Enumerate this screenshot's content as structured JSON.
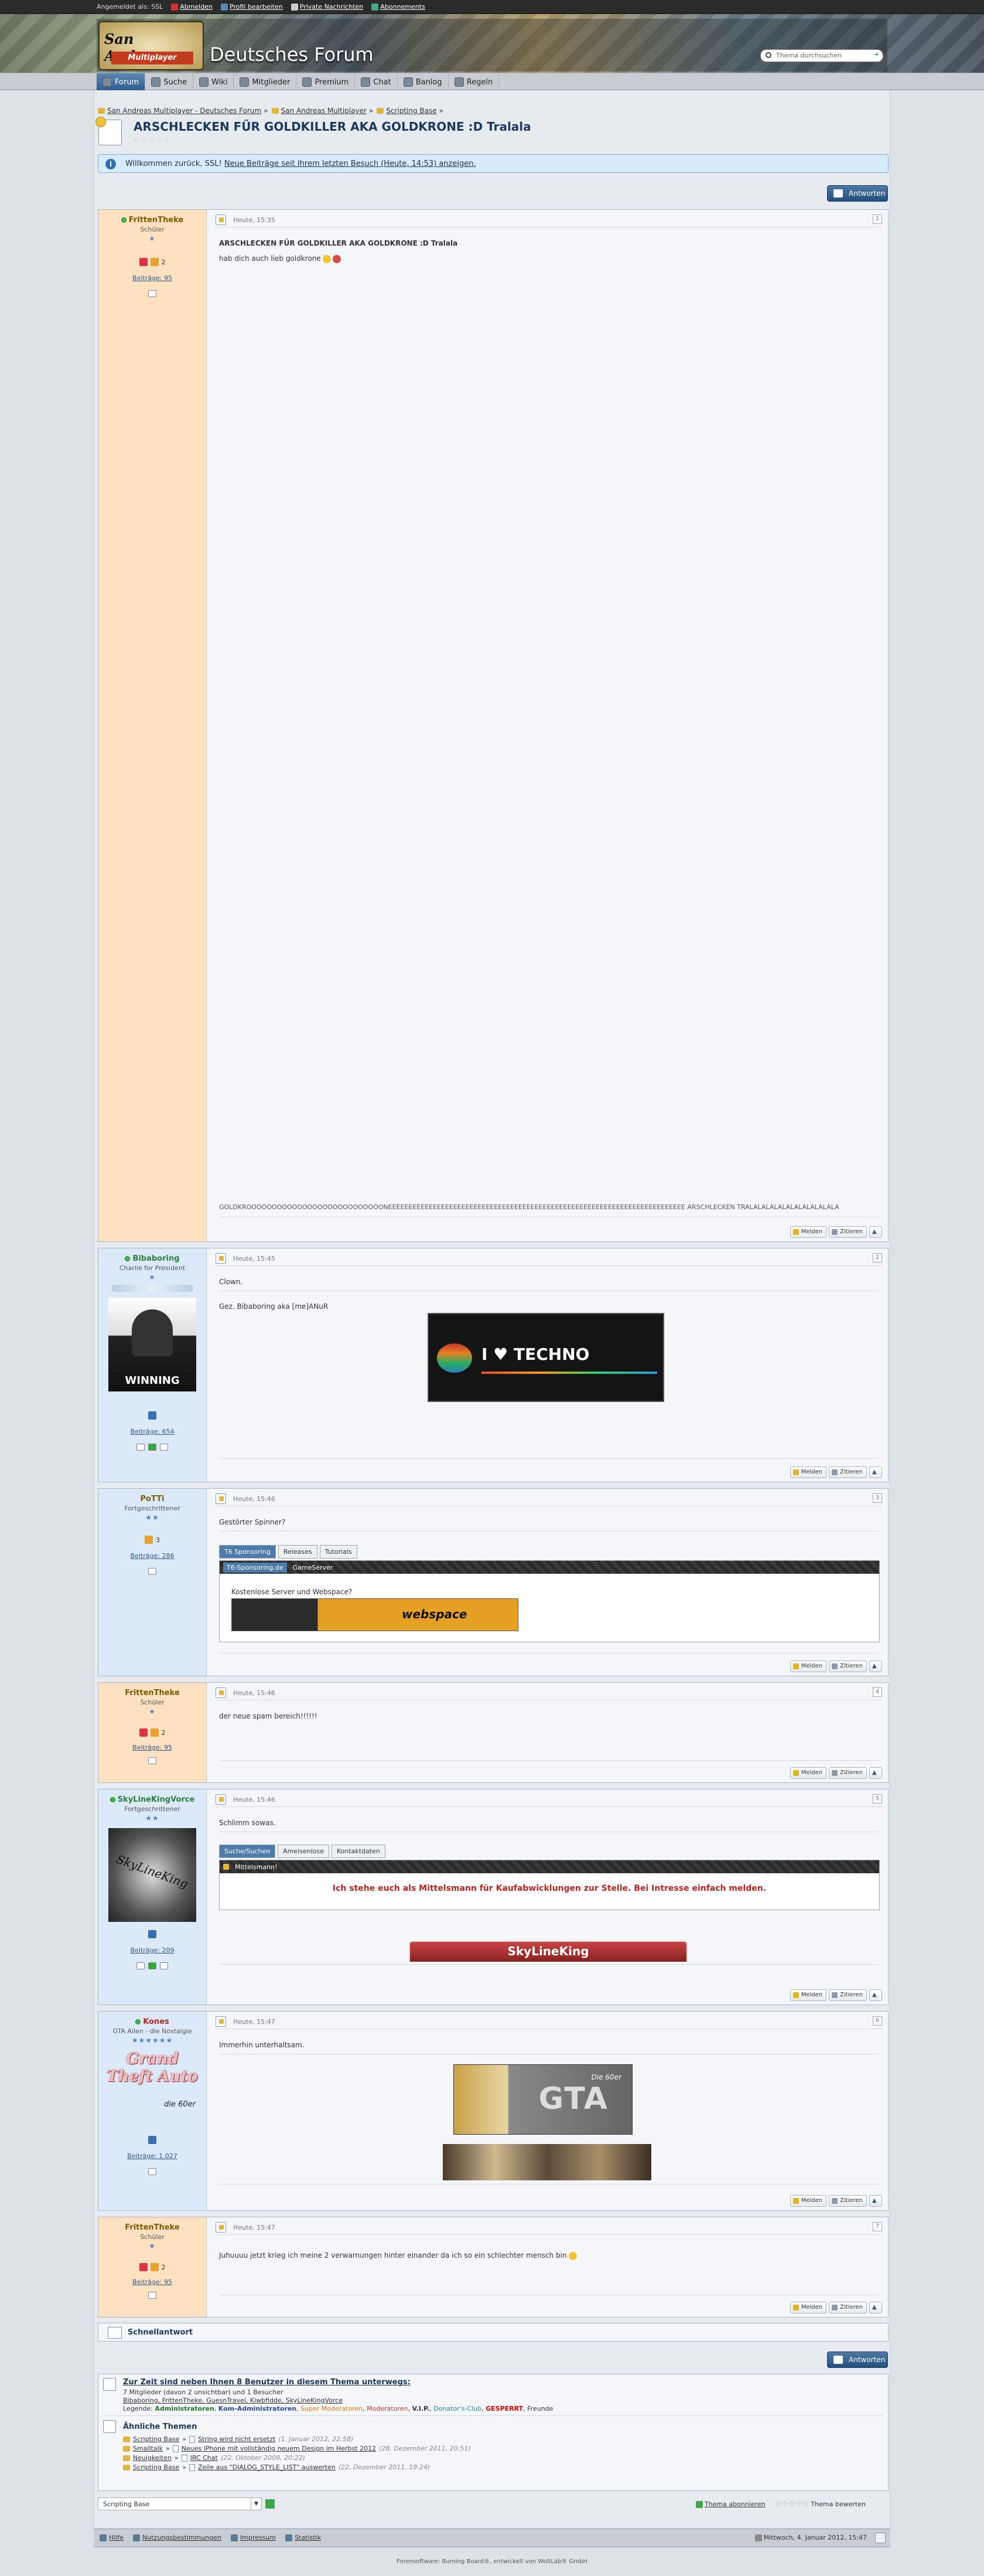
{
  "userbar": {
    "logged_in": "Angemeldet als: SSL",
    "logout": "Abmelden",
    "profile": "Profil bearbeiten",
    "messages": "Private Nachrichten",
    "subscriptions": "Abonnements"
  },
  "header": {
    "logo_line1": "San Andreas",
    "logo_line2": "Multiplayer",
    "site_title": "Deutsches Forum",
    "search_placeholder": "Thema durchsuchen"
  },
  "menu": [
    "Forum",
    "Suche",
    "Wiki",
    "Mitglieder",
    "Premium",
    "Chat",
    "Banlog",
    "Regeln"
  ],
  "breadcrumb": [
    "San Andreas Multiplayer - Deutsches Forum",
    "San Andreas Multiplayer",
    "Scripting Base"
  ],
  "thread": {
    "title": "ARSCHLECKEN FÜR GOLDKILLER AKA GOLDKRONE :D Tralala",
    "rating_stars": "☆☆☆☆☆"
  },
  "welcome": {
    "text": "Willkommen zurück, SSL!",
    "link": "Neue Beiträge seit Ihrem letzten Besuch (Heute, 14:53) anzeigen."
  },
  "buttons": {
    "reply": "Antworten",
    "report": "Melden",
    "quote": "Zitieren"
  },
  "posts": [
    {
      "user": "FrittenTheke",
      "rank": "Schüler",
      "stars": "★",
      "posts": "Beiträge: 95",
      "time": "Heute, 15:35",
      "num": "1",
      "title": "ARSCHLECKEN FÜR GOLDKILLER AKA GOLDKRONE :D Tralala",
      "line1": "hab dich auch lieb goldkrone",
      "long": "GOLDKROOOOOOOOOOOOOOOOOOOOOOOOOOONEEEEEEEEEEEEEEEEEEEEEEEEEEEEEEEEEEEEEEEEEEEEEEEEEEEEEEEEEEEEEEEEEEEEEEEEE ARSCHLECKEN TRALALALALALALALALALALALA"
    },
    {
      "user": "Bibaboring",
      "rank": "Charlie for President",
      "stars": "★",
      "posts": "Beiträge: 654",
      "time": "Heute, 15:45",
      "num": "2",
      "line1": "Clown.",
      "line2": "Gez. Bibaboring aka [me]ANuR",
      "banner": "I ♥ TECHNO",
      "avatar_text": "WINNING"
    },
    {
      "user": "PoTTi",
      "rank": "Fortgeschrittener",
      "stars": "★★",
      "posts": "Beiträge: 286",
      "time": "Heute, 15:46",
      "num": "3",
      "line1": "Gestörter Spinner?",
      "tabs": [
        "T6 Sponsoring",
        "Releases",
        "Tutorials"
      ],
      "subtabs": [
        "T6-Sponsoring.de",
        "GameServer"
      ],
      "ad_text": "Kostenlose Server und Webspace?",
      "ad_label": "webspace"
    },
    {
      "user": "FrittenTheke",
      "rank": "Schüler",
      "stars": "★",
      "posts": "Beiträge: 95",
      "time": "Heute, 15:46",
      "num": "4",
      "line1": "der neue spam bereich!!!!!!"
    },
    {
      "user": "SkyLineKingVorce",
      "rank": "Fortgeschrittener",
      "stars": "★★",
      "posts": "Beiträge: 209",
      "time": "Heute, 15:46",
      "num": "5",
      "line1": "Schlimm sowas.",
      "tabs": [
        "Suche/Suchen",
        "Ameisenlose",
        "Kontaktdaten"
      ],
      "subtab": "Mittelsmann!",
      "offer": "Ich stehe euch als Mittelsmann für Kaufabwicklungen zur Stelle. Bei Intresse einfach melden.",
      "banner": "SkyLineKing",
      "avatar_text": "SkyLineKing"
    },
    {
      "user": "Kones",
      "rank": "GTA Allen - die Nostalgie",
      "stars": "★★★★★★",
      "posts": "Beiträge: 1.027",
      "time": "Heute, 15:47",
      "num": "6",
      "line1": "Immerhin unterhaltsam.",
      "avatar_text": "Grand Theft Auto",
      "avatar_sub": "die 60er",
      "banner": "GTA",
      "banner_sub": "Die 60er"
    },
    {
      "user": "FrittenTheke",
      "rank": "Schüler",
      "stars": "★",
      "posts": "Beiträge: 95",
      "time": "Heute, 15:47",
      "num": "7",
      "line1": "Juhuuuu jetzt krieg ich meine 2 verwarnungen hinter einander da ich so ein schlechter mensch bin"
    }
  ],
  "quickreply": "Schnellantwort",
  "online": {
    "title": "Zur Zeit sind neben Ihnen 8 Benutzer in diesem Thema unterwegs:",
    "summary": "7 Mitglieder (davon 2 unsichtbar) und 1 Besucher",
    "names": "Bibaboring, FrittenTheke, GuesnTravel, Kiwbfidde, SkyLineKingVorce",
    "legend_label": "Legende:",
    "legend": [
      "Administratoren",
      "Kom-Administratoren",
      "Super Moderatoren",
      "Moderatoren",
      "V.I.P.",
      "Donator's-Club",
      "GESPERRT",
      "Freunde"
    ]
  },
  "similar": {
    "title": "Ähnliche Themen",
    "items": [
      {
        "forum": "Scripting Base",
        "topic": "String wird nicht ersetzt",
        "date": "(1. Januar 2012, 22:58)"
      },
      {
        "forum": "Smalltalk",
        "topic": "Neues iPhone mit vollständig neuem Design im Herbst 2012",
        "date": "(28. Dezember 2011, 20:51)"
      },
      {
        "forum": "Neuigkeiten",
        "topic": "IRC Chat",
        "date": "(22. Oktober 2009, 20:22)"
      },
      {
        "forum": "Scripting Base",
        "topic": "Zeile aus \"DIALOG_STYLE_LIST\" auswerten",
        "date": "(22. Dezember 2011, 19:24)"
      }
    ]
  },
  "bottom": {
    "jump": "Scripting Base",
    "subscribe": "Thema abonnieren",
    "rate": "Thema bewerten",
    "rate_stars": "☆☆☆☆☆"
  },
  "footer": {
    "links": [
      "Hilfe",
      "Nutzungsbestimmungen",
      "Impressum",
      "Statistik"
    ],
    "date": "Mittwoch, 4. Januar 2012, 15:47",
    "copyright": "Forensoftware: Burning Board®, entwickelt von WoltLab® GmbH"
  },
  "colors": {
    "accent": "#2f5d8d",
    "online": "#3db84a",
    "link": "#2a5a8a"
  }
}
